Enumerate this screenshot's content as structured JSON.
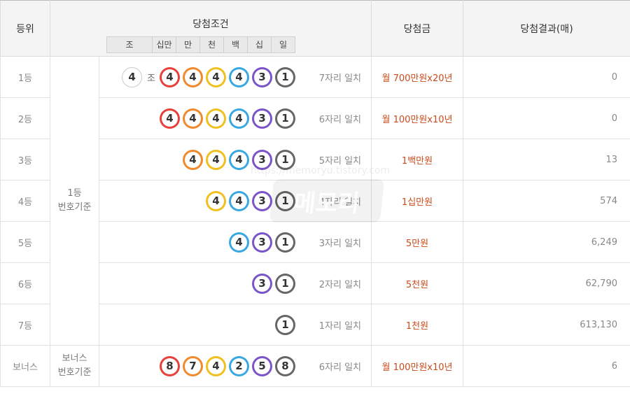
{
  "header": {
    "rank": "등위",
    "condition": "당첨조건",
    "prize": "당첨금",
    "result": "당첨결과(매)",
    "positions": [
      "조",
      "십만",
      "만",
      "천",
      "백",
      "십",
      "일"
    ]
  },
  "basis_main": [
    "1등",
    "번호기준"
  ],
  "basis_bonus": [
    "보너스",
    "번호기준"
  ],
  "ball_colors": {
    "8": "#e8403a",
    "7": "#f08a2c",
    "4a": "#e8403a",
    "4b": "#f08a2c",
    "4c": "#f0c020",
    "4d": "#3aa8e0",
    "3": "#7a54c8",
    "1": "#666666",
    "2": "#3aa8e0",
    "5": "#7a54c8"
  },
  "rows": [
    {
      "rank": "1등",
      "jo": "4",
      "jo_label": "조",
      "balls": [
        {
          "n": "4",
          "c": "#e8403a"
        },
        {
          "n": "4",
          "c": "#f08a2c"
        },
        {
          "n": "4",
          "c": "#f0c020"
        },
        {
          "n": "4",
          "c": "#3aa8e0"
        },
        {
          "n": "3",
          "c": "#7a54c8"
        },
        {
          "n": "1",
          "c": "#666666"
        }
      ],
      "match": "7자리 일치",
      "prize": "월 700만원x20년",
      "result": "0"
    },
    {
      "rank": "2등",
      "balls": [
        {
          "n": "4",
          "c": "#e8403a"
        },
        {
          "n": "4",
          "c": "#f08a2c"
        },
        {
          "n": "4",
          "c": "#f0c020"
        },
        {
          "n": "4",
          "c": "#3aa8e0"
        },
        {
          "n": "3",
          "c": "#7a54c8"
        },
        {
          "n": "1",
          "c": "#666666"
        }
      ],
      "match": "6자리 일치",
      "prize": "월 100만원x10년",
      "result": "0"
    },
    {
      "rank": "3등",
      "balls": [
        {
          "n": "4",
          "c": "#f08a2c"
        },
        {
          "n": "4",
          "c": "#f0c020"
        },
        {
          "n": "4",
          "c": "#3aa8e0"
        },
        {
          "n": "3",
          "c": "#7a54c8"
        },
        {
          "n": "1",
          "c": "#666666"
        }
      ],
      "match": "5자리 일치",
      "prize": "1백만원",
      "result": "13"
    },
    {
      "rank": "4등",
      "balls": [
        {
          "n": "4",
          "c": "#f0c020"
        },
        {
          "n": "4",
          "c": "#3aa8e0"
        },
        {
          "n": "3",
          "c": "#7a54c8"
        },
        {
          "n": "1",
          "c": "#666666"
        }
      ],
      "match": "4자리 일치",
      "prize": "1십만원",
      "result": "574"
    },
    {
      "rank": "5등",
      "balls": [
        {
          "n": "4",
          "c": "#3aa8e0"
        },
        {
          "n": "3",
          "c": "#7a54c8"
        },
        {
          "n": "1",
          "c": "#666666"
        }
      ],
      "match": "3자리 일치",
      "prize": "5만원",
      "result": "6,249"
    },
    {
      "rank": "6등",
      "balls": [
        {
          "n": "3",
          "c": "#7a54c8"
        },
        {
          "n": "1",
          "c": "#666666"
        }
      ],
      "match": "2자리 일치",
      "prize": "5천원",
      "result": "62,790"
    },
    {
      "rank": "7등",
      "balls": [
        {
          "n": "1",
          "c": "#666666"
        }
      ],
      "match": "1자리 일치",
      "prize": "1천원",
      "result": "613,130"
    },
    {
      "rank": "보너스",
      "balls": [
        {
          "n": "8",
          "c": "#e8403a"
        },
        {
          "n": "7",
          "c": "#f08a2c"
        },
        {
          "n": "4",
          "c": "#f0c020"
        },
        {
          "n": "2",
          "c": "#3aa8e0"
        },
        {
          "n": "5",
          "c": "#7a54c8"
        },
        {
          "n": "8",
          "c": "#666666"
        }
      ],
      "match": "6자리 일치",
      "prize": "월 100만원x10년",
      "result": "6"
    }
  ],
  "watermark": {
    "url": "https://memoryu.tistory.com",
    "logo": "메모리"
  }
}
